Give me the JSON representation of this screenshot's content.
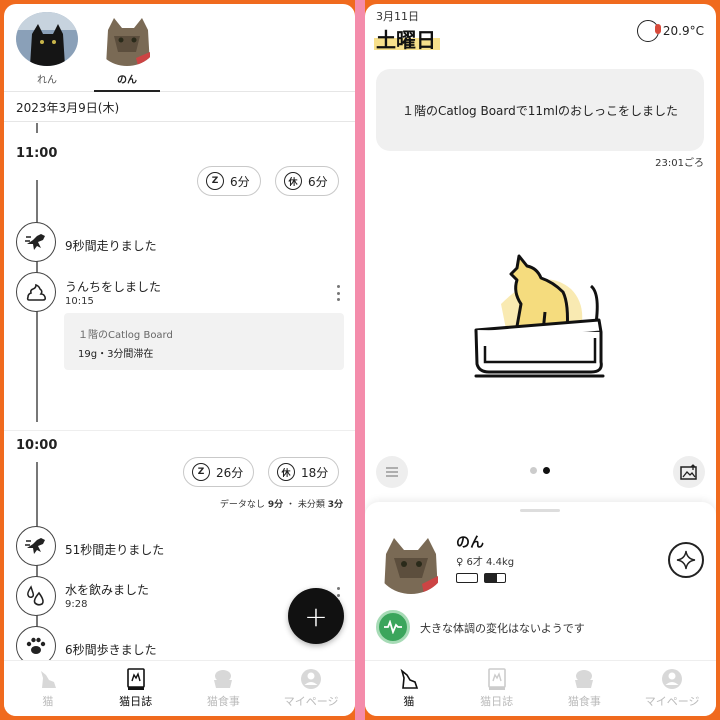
{
  "left": {
    "cats": [
      {
        "name": "れん",
        "active": false
      },
      {
        "name": "のん",
        "active": true
      }
    ],
    "date": "2023年3月9日(木)",
    "hours": [
      {
        "label": "11:00",
        "sleep": "6分",
        "rest": "6分",
        "summary": null,
        "events": [
          {
            "title": "9秒間走りました",
            "time": "",
            "icon": "running-cat-icon"
          },
          {
            "title": "うんちをしました",
            "time": "10:15",
            "icon": "poop-icon",
            "detail": {
              "place": "１階のCatlog Board",
              "info": "19g・3分間滞在"
            }
          }
        ]
      },
      {
        "label": "10:00",
        "sleep": "26分",
        "rest": "18分",
        "summary": {
          "nodata_label": "データなし",
          "nodata": "9分",
          "sep": "・",
          "unclass_label": "未分類",
          "unclass": "3分"
        },
        "events": [
          {
            "title": "51秒間走りました",
            "time": "",
            "icon": "running-cat-icon"
          },
          {
            "title": "水を飲みました",
            "time": "9:28",
            "icon": "water-drop-icon"
          },
          {
            "title": "6秒間歩きました",
            "time": "",
            "icon": "paw-icon"
          }
        ]
      }
    ],
    "sleep_icon_glyph": "Z",
    "rest_icon_glyph": "休",
    "fab_label": "+"
  },
  "nav": [
    {
      "label": "猫",
      "icon": "cat-icon"
    },
    {
      "label": "猫日誌",
      "icon": "diary-icon"
    },
    {
      "label": "猫食事",
      "icon": "food-bowl-icon"
    },
    {
      "label": "マイページ",
      "icon": "profile-icon"
    }
  ],
  "left_nav_active": 1,
  "right_nav_active": 0,
  "right": {
    "date": "3月11日",
    "weekday": "土曜日",
    "temperature": "20.9°C",
    "message": "１階のCatlog Boardで11mlのおしっこをしました",
    "message_time": "23:01ごろ",
    "carousel": {
      "pages": 2,
      "current": 1
    },
    "cat": {
      "name": "のん",
      "meta": "♀ 6才 4.4kg"
    },
    "health": "大きな体調の変化はないようです"
  },
  "colors": {
    "accent_orange": "#f06a1e",
    "highlight_yellow": "#f7e08c",
    "cat_yellow": "#f5dc7e",
    "health_green": "#3ba55c"
  }
}
